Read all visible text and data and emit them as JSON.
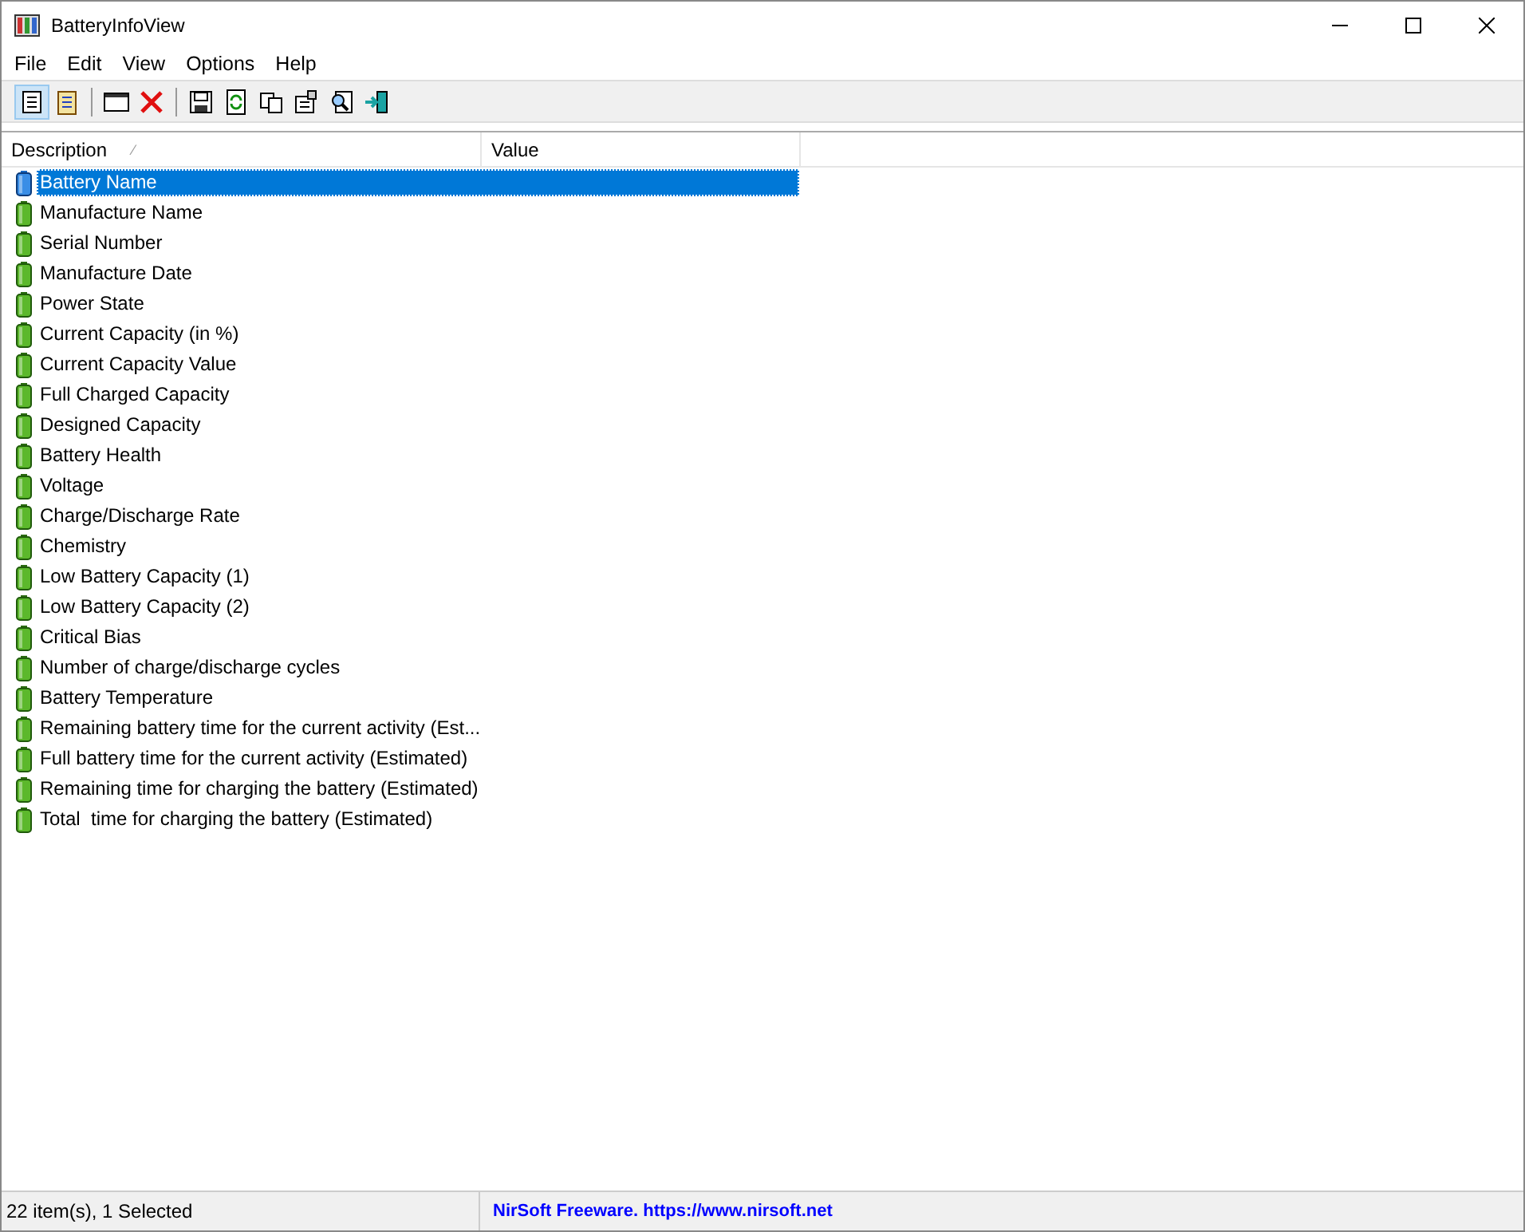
{
  "window": {
    "title": "BatteryInfoView"
  },
  "menu": [
    "File",
    "Edit",
    "View",
    "Options",
    "Help"
  ],
  "toolbar": [
    {
      "kind": "report",
      "pressed": true
    },
    {
      "kind": "clipboard-report",
      "pressed": false
    },
    {
      "kind": "sep"
    },
    {
      "kind": "window",
      "pressed": false
    },
    {
      "kind": "delete",
      "pressed": false
    },
    {
      "kind": "sep"
    },
    {
      "kind": "save",
      "pressed": false
    },
    {
      "kind": "refresh",
      "pressed": false
    },
    {
      "kind": "copy",
      "pressed": false
    },
    {
      "kind": "properties",
      "pressed": false
    },
    {
      "kind": "find",
      "pressed": false
    },
    {
      "kind": "exit",
      "pressed": false
    }
  ],
  "table": {
    "columns": [
      {
        "label": "Description",
        "sort_mark": "⁄"
      },
      {
        "label": "Value"
      }
    ],
    "rows": [
      {
        "description": "Battery Name",
        "selected": true
      },
      {
        "description": "Manufacture Name",
        "selected": false
      },
      {
        "description": "Serial Number",
        "selected": false
      },
      {
        "description": "Manufacture Date",
        "selected": false
      },
      {
        "description": "Power State",
        "selected": false
      },
      {
        "description": "Current Capacity (in %)",
        "selected": false
      },
      {
        "description": "Current Capacity Value",
        "selected": false
      },
      {
        "description": "Full Charged Capacity",
        "selected": false
      },
      {
        "description": "Designed Capacity",
        "selected": false
      },
      {
        "description": "Battery Health",
        "selected": false
      },
      {
        "description": "Voltage",
        "selected": false
      },
      {
        "description": "Charge/Discharge Rate",
        "selected": false
      },
      {
        "description": "Chemistry",
        "selected": false
      },
      {
        "description": "Low Battery Capacity (1)",
        "selected": false
      },
      {
        "description": "Low Battery Capacity (2)",
        "selected": false
      },
      {
        "description": "Critical Bias",
        "selected": false
      },
      {
        "description": "Number of charge/discharge cycles",
        "selected": false
      },
      {
        "description": "Battery Temperature",
        "selected": false
      },
      {
        "description": "Remaining battery time for the current activity (Est...",
        "selected": false
      },
      {
        "description": "Full battery time for the current activity (Estimated)",
        "selected": false
      },
      {
        "description": "Remaining time for charging the battery (Estimated)",
        "selected": false
      },
      {
        "description": "Total  time for charging the battery (Estimated)",
        "selected": false
      }
    ]
  },
  "status_bar": {
    "count": "22 item(s), 1 Selected",
    "link": "NirSoft Freeware. https://www.nirsoft.net"
  }
}
